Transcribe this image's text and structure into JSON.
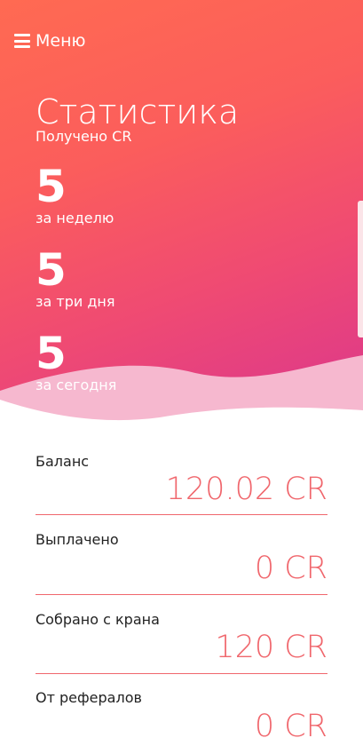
{
  "header": {
    "menu_label": "Меню"
  },
  "stats": {
    "title": "Статистика",
    "subtitle": "Получено CR",
    "week": {
      "value": "5",
      "label": "за неделю"
    },
    "three_days": {
      "value": "5",
      "label": "за три дня"
    },
    "today": {
      "value": "5",
      "label": "за сегодня"
    }
  },
  "balances": [
    {
      "label": "Баланс",
      "value": "120.02 CR"
    },
    {
      "label": "Выплачено",
      "value": "0 CR"
    },
    {
      "label": "Собрано с крана",
      "value": "120 CR"
    },
    {
      "label": "От рефералов",
      "value": "0 CR"
    }
  ],
  "colors": {
    "gradient_start": "#ff6a52",
    "gradient_end": "#d9358f",
    "value_color": "#f0676d",
    "wave_light": "#f6b8cf"
  }
}
